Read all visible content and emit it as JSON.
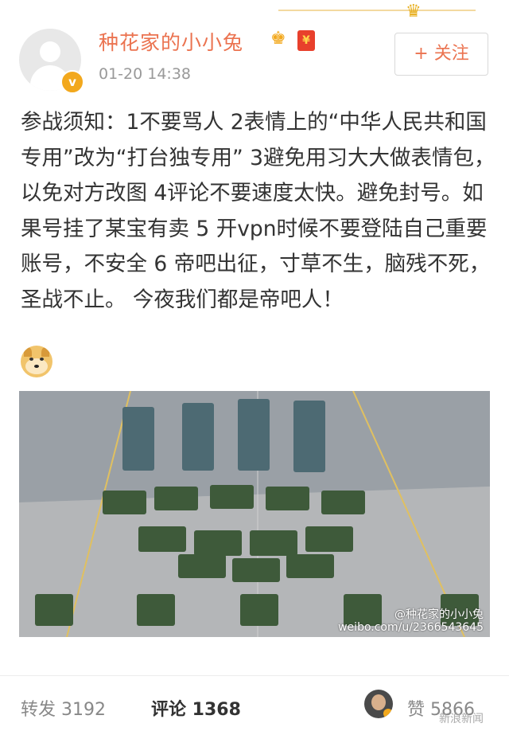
{
  "post": {
    "author": "种花家的小小兔",
    "time": "01-20 14:38",
    "follow_label": "+ 关注",
    "verified_mark": "v",
    "text": "参战须知：1不要骂人 2表情上的“中华人民共和国专用”改为“打台独专用” 3避免用习大大做表情包，以免对方改图 4评论不要速度太快。避免封号。如果号挂了某宝有卖 5 开vpn时候不要登陆自己重要账号，不安全 6 帝吧出征，寸草不生，脑残不死，圣战不止。 今夜我们都是帝吧人！",
    "image_watermark_line1": "@种花家的小小兔",
    "image_watermark_line2": "weibo.com/u/2366543645"
  },
  "footer": {
    "repost": "转发 3192",
    "comment": "评论 1368",
    "like": "赞 5866",
    "watermark": "新浪新闻"
  },
  "icons": {
    "crown": "crown-icon",
    "vip": "vip-crown-icon",
    "hongbao": "red-envelope-icon",
    "emoji": "doge-emoji-icon"
  },
  "colors": {
    "accent": "#eb7350",
    "verified": "#f2a81d",
    "text": "#333333",
    "muted": "#999999"
  }
}
